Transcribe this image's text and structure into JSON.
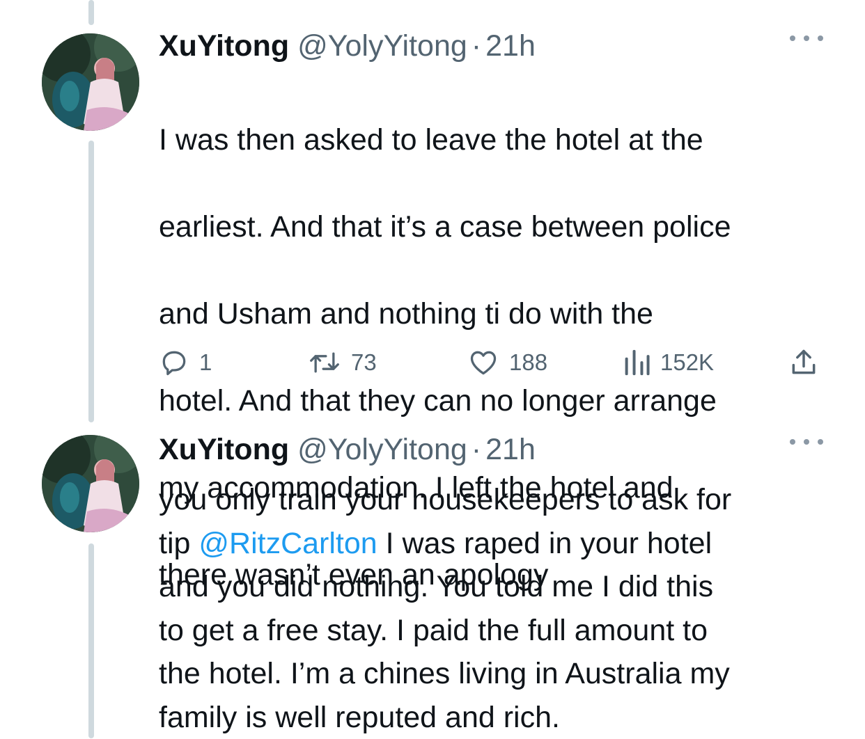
{
  "tweets": [
    {
      "author_name": "XuYitong",
      "handle": "@YolyYitong",
      "separator": "·",
      "time": "21h",
      "text_lines": [
        "I was then asked to leave the hotel at the",
        "earliest. And that it’s a case between police",
        "and Usham and nothing ti do with the",
        "hotel. And that they can no longer arrange",
        "my accommodation. I left the hotel and",
        "there wasn’t even an apology"
      ],
      "stats": {
        "replies": "1",
        "retweets": "73",
        "likes": "188",
        "views": "152K"
      }
    },
    {
      "author_name": "XuYitong",
      "handle": "@YolyYitong",
      "separator": "·",
      "time": "21h",
      "text_before_mention": "you only train your housekeepers to ask for\ntip ",
      "mention": "@RitzCarlton",
      "text_after_mention": " I was raped in your hotel\nand you did nothing. You told me I did this\nto get a free stay. I paid the full amount to\nthe hotel. I’m a chines living in Australia my\nfamily is well reputed and rich."
    }
  ],
  "icons": {
    "reply": "reply-icon",
    "retweet": "retweet-icon",
    "like": "heart-icon",
    "views": "views-icon",
    "share": "share-icon",
    "more": "more-icon"
  },
  "colors": {
    "text": "#0f1419",
    "secondary": "#536471",
    "link": "#1d9bf0",
    "thread_line": "#cfd9de"
  }
}
